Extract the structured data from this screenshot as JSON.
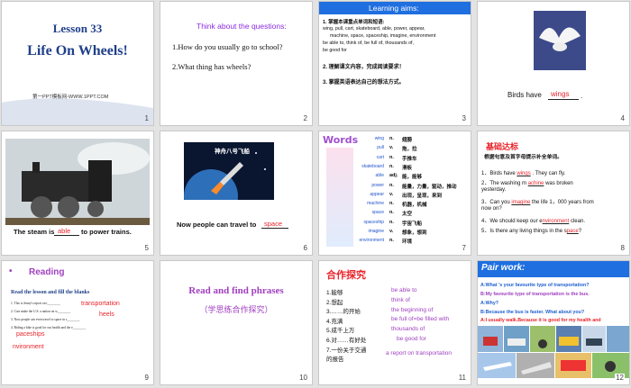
{
  "slides": [
    {
      "n": "1",
      "lesson": "Lesson 33",
      "title": "Life On Wheels!",
      "footer": "第一PPT模板网-WWW.1PPT.COM"
    },
    {
      "n": "2",
      "heading": "Think about the questions:",
      "q1": "1.How do you usually go to school?",
      "q2": "2.What thing has wheels?"
    },
    {
      "n": "3",
      "title": "Learning aims:",
      "l1": "1. 掌握本课重点单词和短语:",
      "l2": "wing, pull, cart, skateboard, able, power, appear,",
      "l3": "machine, space, spaceship, imagine, environment",
      "l4": "be able to, think of, be full of, thousands of,",
      "l5": "be good for",
      "l6": "2. 理解课文内容，完成阅读要求！",
      "l7": "3. 掌握英语表达自己的想法方式。"
    },
    {
      "n": "4",
      "text": "Birds have",
      "answer": "wings",
      "end": "."
    },
    {
      "n": "5",
      "pre": "The steam is",
      "answer": "able",
      "post": "to power trains."
    },
    {
      "n": "6",
      "caption": "Now people can travel to",
      "answer": "space",
      "sign": "神舟八号飞船"
    },
    {
      "n": "7",
      "logo": "Words",
      "words": [
        {
          "en": "wing",
          "pos": "n.",
          "cn": "翅膀"
        },
        {
          "en": "pull",
          "pos": "v.",
          "cn": "拖，拉"
        },
        {
          "en": "cart",
          "pos": "n.",
          "cn": "手推车"
        },
        {
          "en": "skateboard",
          "pos": "n.",
          "cn": "滑板"
        },
        {
          "en": "able",
          "pos": "adj.",
          "cn": "能，能够"
        },
        {
          "en": "power",
          "pos": "n.",
          "cn": "能量，力量，驱动，推动"
        },
        {
          "en": "appear",
          "pos": "v.",
          "cn": "出现，呈现，来到"
        },
        {
          "en": "machine",
          "pos": "n.",
          "cn": "机器，机械"
        },
        {
          "en": "space",
          "pos": "n.",
          "cn": "太空"
        },
        {
          "en": "spaceship",
          "pos": "n.",
          "cn": "宇宙飞船"
        },
        {
          "en": "imagine",
          "pos": "v.",
          "cn": "想象，想到"
        },
        {
          "en": "environment",
          "pos": "n.",
          "cn": "环境"
        }
      ]
    },
    {
      "n": "8",
      "title": "基础达标",
      "sub": "根据句意及首字母提示补全单词。",
      "s1a": "1．Birds have",
      "s1w": "wings",
      "s1b": ". They can fly.",
      "s2a": "2．The washing m",
      "s2w": "achine",
      "s2b": "was broken",
      "s2c": "yesterday.",
      "s3a": "3．Can you",
      "s3w": "imagine",
      "s3b": "the life 1，000 years from",
      "s3c": "now on?",
      "s4a": "4．We should keep our e",
      "s4w": "nvironment",
      "s4b": "clean.",
      "s5a": "5．Is there any living  things in the s",
      "s5w": "pace",
      "s5b": "?"
    },
    {
      "n": "9",
      "bullet": "•",
      "title": "Reading",
      "sub": "Read  the lesson and fill the blanks",
      "r1": "1. This is Jenny's report on t________",
      "r2": "2. Cars make the U.S. a nation on w________",
      "r3": "3. Now people can even travel to space in s________",
      "r4": "4. Riding a bike is good for our health and the e________",
      "a1": "transportation",
      "a2": "heels",
      "a3": "paceships",
      "a4": "nvironment"
    },
    {
      "n": "10",
      "title": "Read and find phrases",
      "sub": "（学思练合作探究）"
    },
    {
      "n": "11",
      "title": "合作探究",
      "cn": [
        "1.能够",
        "2.想起",
        "3.……的开始",
        "4.充满",
        "5.成千上万",
        "6.对……有好处",
        "7.一份关于交通",
        "的报告"
      ],
      "en": [
        "be able to",
        "think of",
        "the beginning of",
        "be full of=be filled with",
        "thousands of",
        "be good for",
        "a report on transportation"
      ]
    },
    {
      "n": "12",
      "title": "Pair work:",
      "q1": "A:What 's your favourite type of transportation?",
      "a1": "B:My favourite type of transportation is the bus.",
      "q2": "A:Why?",
      "a2": "B:Because the bus is faster. What about you?",
      "a3": "A:I  usually walk.Because it is good for my health and"
    }
  ]
}
